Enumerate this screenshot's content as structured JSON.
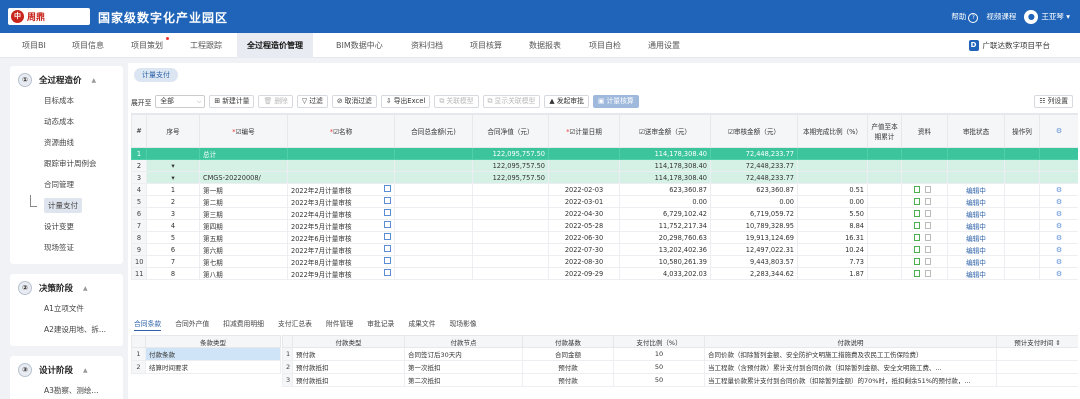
{
  "app": {
    "logo_text": "周鼎",
    "title": "国家级数字化产业园区"
  },
  "topbar": {
    "help": "帮助",
    "video": "视频课程",
    "user": "王亚琴"
  },
  "tabs": [
    {
      "label": "项目BI"
    },
    {
      "label": "项目信息"
    },
    {
      "label": "项目策划"
    },
    {
      "label": "工程跟踪"
    },
    {
      "label": "全过程造价管理"
    },
    {
      "label": "BIM数据中心"
    },
    {
      "label": "资料归档"
    },
    {
      "label": "项目核算"
    },
    {
      "label": "数据报表"
    },
    {
      "label": "项目自检"
    },
    {
      "label": "通用设置"
    }
  ],
  "platform": {
    "label": "广联达数字项目平台"
  },
  "sidebar": {
    "g1": {
      "num": "①",
      "title": "全过程造价",
      "items": [
        "目标成本",
        "动态成本",
        "资源曲线",
        "跟踪审计周例会",
        "合同管理",
        "计量支付",
        "设计变更",
        "现场签证"
      ]
    },
    "g2": {
      "num": "②",
      "title": "决策阶段",
      "items": [
        "A1立项文件",
        "A2建设用地、拆..."
      ]
    },
    "g3": {
      "num": "③",
      "title": "设计阶段",
      "items": [
        "A3勘察、测绘..."
      ]
    }
  },
  "main": {
    "pill": "计量支付",
    "toolbar": {
      "expand_label": "展开至",
      "expand_value": "全部",
      "buttons": [
        "新建计量",
        "删除",
        "过滤",
        "取消过滤",
        "导出Excel",
        "关联模型",
        "显示关联模型",
        "发起审批",
        "计量核算"
      ],
      "colset": "列设置"
    },
    "columns": [
      "#",
      "序号",
      "编号",
      "名称",
      "合同总金额(元)",
      "合同净值（元）",
      "计量日期",
      "送审金额（元）",
      "审核金额（元）",
      "本期完成比例（%）",
      "产值至本期累计",
      "资料",
      "审批状态",
      "操作列"
    ],
    "rows": [
      {
        "n": "1",
        "seq": "",
        "code": "总计",
        "name": "",
        "total": "",
        "net": "122,095,757.50",
        "date": "",
        "sub": "114,178,308.40",
        "aud": "72,448,233.77",
        "pct": "",
        "kind": "tot"
      },
      {
        "n": "2",
        "seq": "▾",
        "code": "",
        "name": "",
        "total": "",
        "net": "122,095,757.50",
        "date": "",
        "sub": "114,178,308.40",
        "aud": "72,448,233.77",
        "pct": "",
        "kind": "sub"
      },
      {
        "n": "3",
        "seq": "▾",
        "code": "CMGS-20220008/",
        "name": "",
        "total": "",
        "net": "122,095,757.50",
        "date": "",
        "sub": "114,178,308.40",
        "aud": "72,448,233.77",
        "pct": "",
        "kind": "sub"
      },
      {
        "n": "4",
        "seq": "1",
        "code": "第一期",
        "name": "2022年2月计量审核",
        "total": "",
        "net": "",
        "date": "2022-02-03",
        "sub": "623,360.87",
        "aud": "623,360.87",
        "pct": "0.51",
        "status": "编辑中",
        "kind": "data"
      },
      {
        "n": "5",
        "seq": "2",
        "code": "第二期",
        "name": "2022年3月计量审核",
        "total": "",
        "net": "",
        "date": "2022-03-01",
        "sub": "0.00",
        "aud": "0.00",
        "pct": "0.00",
        "status": "编辑中",
        "kind": "data"
      },
      {
        "n": "6",
        "seq": "3",
        "code": "第三期",
        "name": "2022年4月计量审核",
        "total": "",
        "net": "",
        "date": "2022-04-30",
        "sub": "6,729,102.42",
        "aud": "6,719,059.72",
        "pct": "5.50",
        "status": "编辑中",
        "kind": "data"
      },
      {
        "n": "7",
        "seq": "4",
        "code": "第四期",
        "name": "2022年5月计量审核",
        "total": "",
        "net": "",
        "date": "2022-05-28",
        "sub": "11,752,217.34",
        "aud": "10,789,328.95",
        "pct": "8.84",
        "status": "编辑中",
        "kind": "data"
      },
      {
        "n": "8",
        "seq": "5",
        "code": "第五期",
        "name": "2022年6月计量审核",
        "total": "",
        "net": "",
        "date": "2022-06-30",
        "sub": "20,298,760.63",
        "aud": "19,913,124.69",
        "pct": "16.31",
        "status": "编辑中",
        "kind": "data"
      },
      {
        "n": "9",
        "seq": "6",
        "code": "第六期",
        "name": "2022年7月计量审核",
        "total": "",
        "net": "",
        "date": "2022-07-30",
        "sub": "13,202,402.36",
        "aud": "12,497,022.31",
        "pct": "10.24",
        "status": "编辑中",
        "kind": "data"
      },
      {
        "n": "10",
        "seq": "7",
        "code": "第七期",
        "name": "2022年8月计量审核",
        "total": "",
        "net": "",
        "date": "2022-08-30",
        "sub": "10,580,261.39",
        "aud": "9,443,803.57",
        "pct": "7.73",
        "status": "编辑中",
        "kind": "data"
      },
      {
        "n": "11",
        "seq": "8",
        "code": "第八期",
        "name": "2022年9月计量审核",
        "total": "",
        "net": "",
        "date": "2022-09-29",
        "sub": "4,033,202.03",
        "aud": "2,283,344.62",
        "pct": "1.87",
        "status": "编辑中",
        "kind": "data"
      }
    ],
    "subtabs": [
      "合同条款",
      "合同外产值",
      "扣减费用明细",
      "支付汇总表",
      "附件管理",
      "审批记录",
      "成果文件",
      "现场影像"
    ],
    "terms": {
      "header": "条款类型",
      "items": [
        "付款条款",
        "结算时间要求"
      ]
    },
    "payments": {
      "columns": [
        "付款类型",
        "付款节点",
        "付款基数",
        "支付比例（%）",
        "付款说明",
        "预计支付时间"
      ],
      "rows": [
        {
          "type": "预付款",
          "node": "合同签订后30天内",
          "base": "合同金额",
          "ratio": "10",
          "desc": "合同价款（扣除暂列金额、安全防护文明施工措施费及农民工工伤保险费）"
        },
        {
          "type": "预付款抵扣",
          "node": "第一次抵扣",
          "base": "预付款",
          "ratio": "50",
          "desc": "当工程款（含预付款）累计支付到合同价款（扣除暂列金额、安全文明施工费、..."
        },
        {
          "type": "预付款抵扣",
          "node": "第二次抵扣",
          "base": "预付款",
          "ratio": "50",
          "desc": "当工程量价款累计支付到合同价款（扣除暂列金额）的70%时，抵扣剩余51%的预付款，..."
        }
      ]
    }
  }
}
